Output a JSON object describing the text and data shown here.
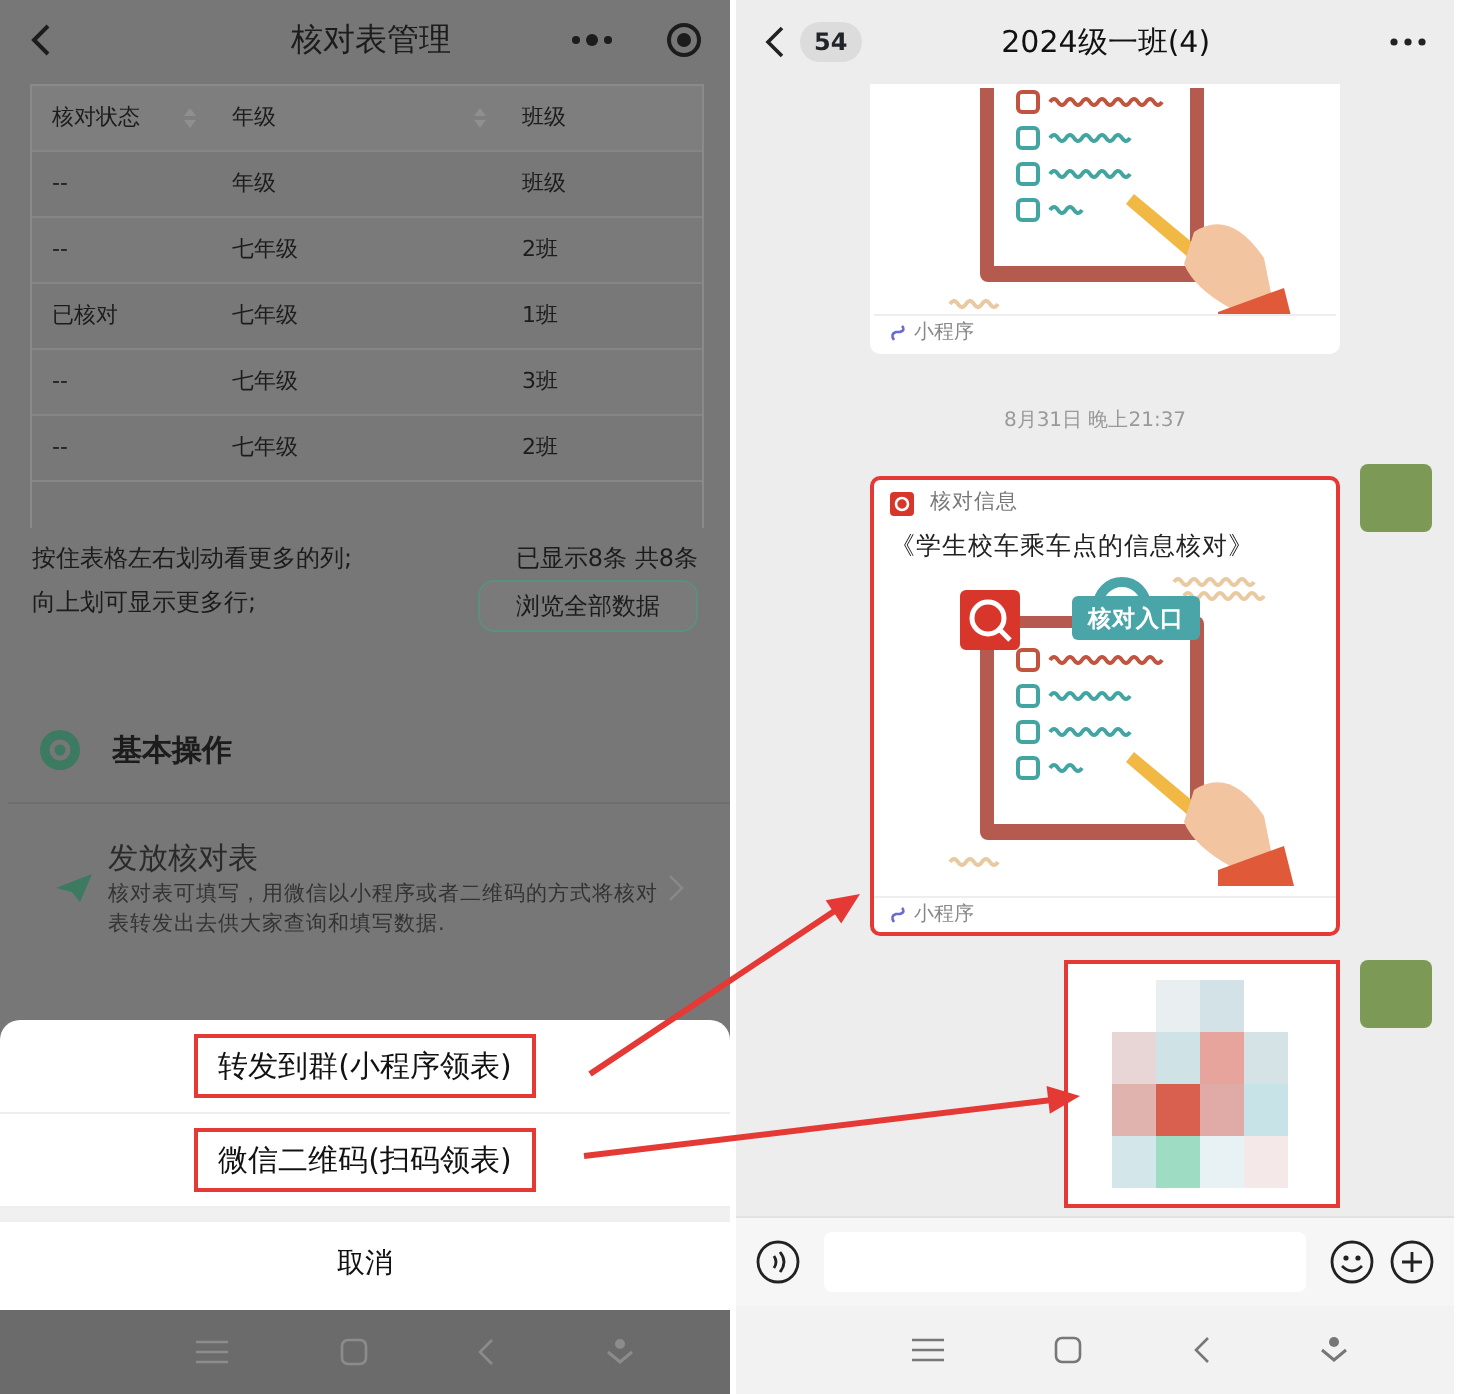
{
  "left_screen": {
    "title": "核对表管理",
    "table": {
      "columns": [
        {
          "label": "核对状态",
          "sortable": true
        },
        {
          "label": "年级",
          "sortable": true
        },
        {
          "label": "班级",
          "sortable": false
        }
      ],
      "rows": [
        [
          "--",
          "年级",
          "班级"
        ],
        [
          "--",
          "七年级",
          "2班"
        ],
        [
          "已核对",
          "七年级",
          "1班"
        ],
        [
          "--",
          "七年级",
          "3班"
        ],
        [
          "--",
          "七年级",
          "2班"
        ]
      ]
    },
    "hint_lines": [
      "按住表格左右划动看更多的列;",
      "向上划可显示更多行;"
    ],
    "count_text": "已显示8条 共8条",
    "browse_button": "浏览全部数据",
    "section_title": "基本操作",
    "actions": [
      {
        "title": "发放核对表",
        "description": "核对表可填写，用微信以小程序或者二维码的方式将核对表转发出去供大家查询和填写数据."
      }
    ],
    "action_sheet": {
      "options": [
        {
          "label": "转发到群(小程序领表)",
          "highlighted": true
        },
        {
          "label": "微信二维码(扫码领表)",
          "highlighted": true
        }
      ],
      "cancel": "取消"
    }
  },
  "right_screen": {
    "title": "2024级一班(4)",
    "unread_count": "54",
    "messages": [
      {
        "kind": "mini_program",
        "avatar_visible": false,
        "highlighted": false,
        "crop_top": true,
        "footer": "小程序"
      },
      {
        "kind": "time",
        "text": "8月31日 晚上21:37"
      },
      {
        "kind": "mini_program",
        "avatar_visible": true,
        "highlighted": true,
        "crop_top": false,
        "app_name": "核对信息",
        "title": "《学生校车乘车点的信息核对》",
        "image_label": "核对入口",
        "footer": "小程序"
      },
      {
        "kind": "image",
        "avatar_visible": true,
        "highlighted": true
      }
    ]
  }
}
